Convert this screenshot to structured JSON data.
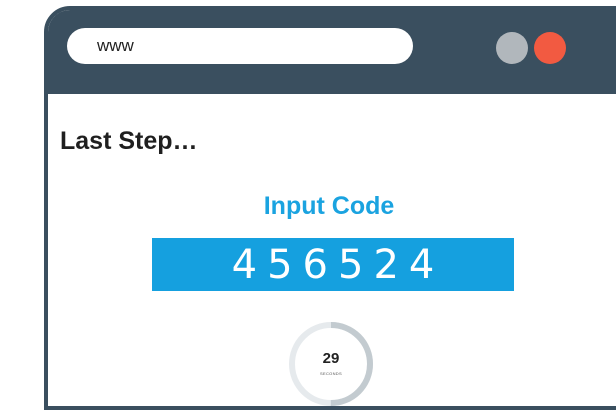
{
  "browser": {
    "address_text": "www",
    "window_buttons": [
      {
        "name": "minimize",
        "color": "#b1b7bc"
      },
      {
        "name": "close",
        "color": "#f25a41"
      }
    ]
  },
  "page": {
    "heading": "Last Step…",
    "code_label": "Input Code",
    "code_value": "456524"
  },
  "timer": {
    "seconds_left": "29",
    "unit_label": "SECONDS",
    "progress_fraction": 0.5
  },
  "colors": {
    "titlebar": "#3a4f5f",
    "accent_blue": "#15a0df",
    "timer_track": "#e6eaed",
    "timer_progress": "#c3cbd0"
  }
}
